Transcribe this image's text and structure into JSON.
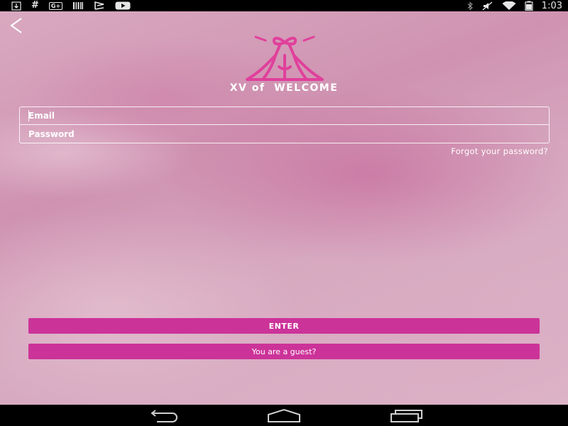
{
  "status_bar": {
    "left_icons": [
      "download-icon",
      "hash-icon",
      "gplus-icon",
      "barcode-icon",
      "flag-icon",
      "youtube-icon"
    ],
    "right_icons": [
      "bluetooth-icon",
      "mute-icon",
      "wifi-icon",
      "battery-icon"
    ],
    "hash_glyph": "#",
    "gplus_glyph": "G+",
    "time": "1:03"
  },
  "header": {
    "back_icon": "back-arrow-icon",
    "logo_icon": "dress-logo-icon",
    "title": "XV of  WELCOME"
  },
  "login": {
    "email_placeholder": "Email",
    "password_placeholder": "Password",
    "forgot_password": "Forgot your password?",
    "enter_label": "ENTER",
    "guest_label": "You are a guest?"
  },
  "nav_bar": {
    "icons": [
      "nav-back-icon",
      "nav-home-icon",
      "nav-recents-icon"
    ]
  },
  "colors": {
    "accent": "#cc3399",
    "logo": "#e0409b",
    "text": "#ffffff"
  }
}
